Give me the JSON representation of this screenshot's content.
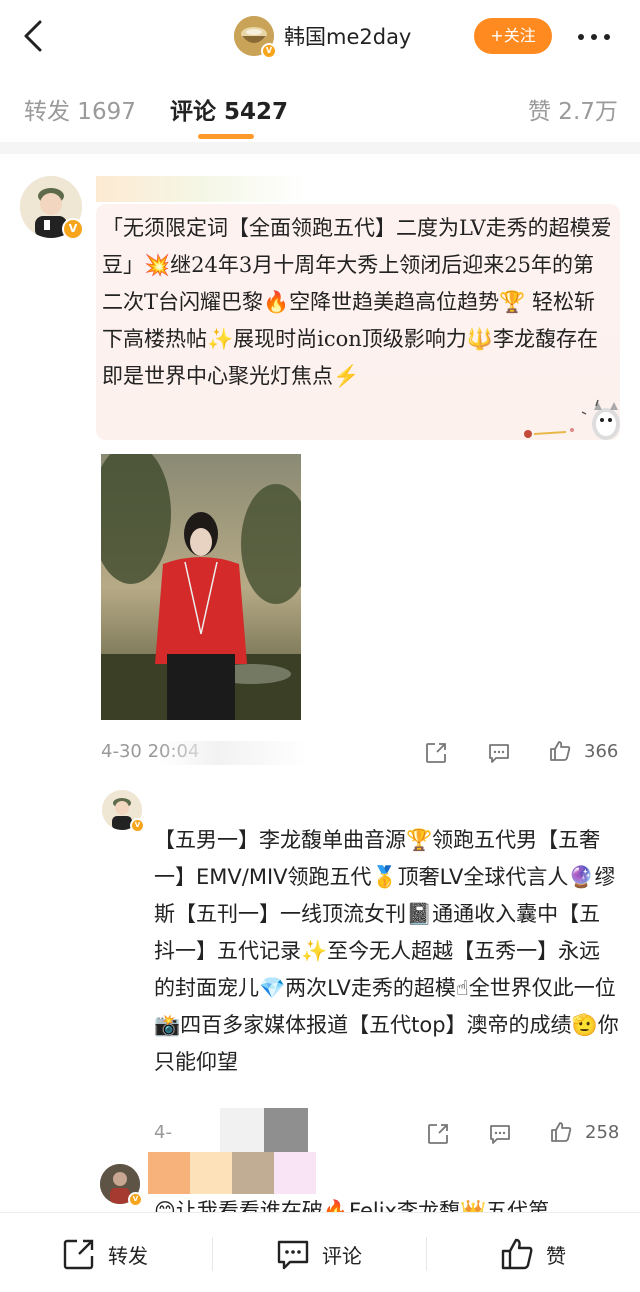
{
  "header": {
    "account_name": "韩国me2day",
    "follow_label": "+关注",
    "icons": {
      "back": "chevron-left-icon",
      "more": "more-dots-icon"
    }
  },
  "tabs": {
    "repost": "转发 1697",
    "comment": "评论 5427",
    "like": "赞 2.7万"
  },
  "comments": [
    {
      "text": "「无须限定词【全面领跑五代】二度为LV走秀的超模爱豆」💥继24年3月十周年大秀上领闭后迎来25年的第二次T台闪耀巴黎🔥空降世趋美趋高位趋势🏆 轻松斩下高楼热帖✨展现时尚icon顶级影响力🔱李龙馥存在即是世界中心聚光灯焦点⚡",
      "time": "4-30 20:04",
      "likes": "366"
    },
    {
      "text": "【五男一】李龙馥单曲音源🏆领跑五代男【五奢一】EMV/MIV领跑五代🥇顶奢LV全球代言人🔮缪斯【五刊一】一线顶流女刊📓通通收入囊中【五抖一】五代记录✨至今无人超越【五秀一】永远的封面宠儿💎两次LV走秀的超模☝全世界仅此一位📸四百多家媒体报道【五代top】澳帝的成绩🫡你只能仰望",
      "time": "4-",
      "likes": "258"
    },
    {
      "text": "😊让我看看谁在破🔥Felix李龙馥👑五代第"
    }
  ],
  "bottom_bar": {
    "repost": "转发",
    "comment": "评论",
    "like": "赞"
  },
  "colors": {
    "accent": "#ff8a1f",
    "tab_underline": "#ff9a2a",
    "muted": "#999999"
  }
}
